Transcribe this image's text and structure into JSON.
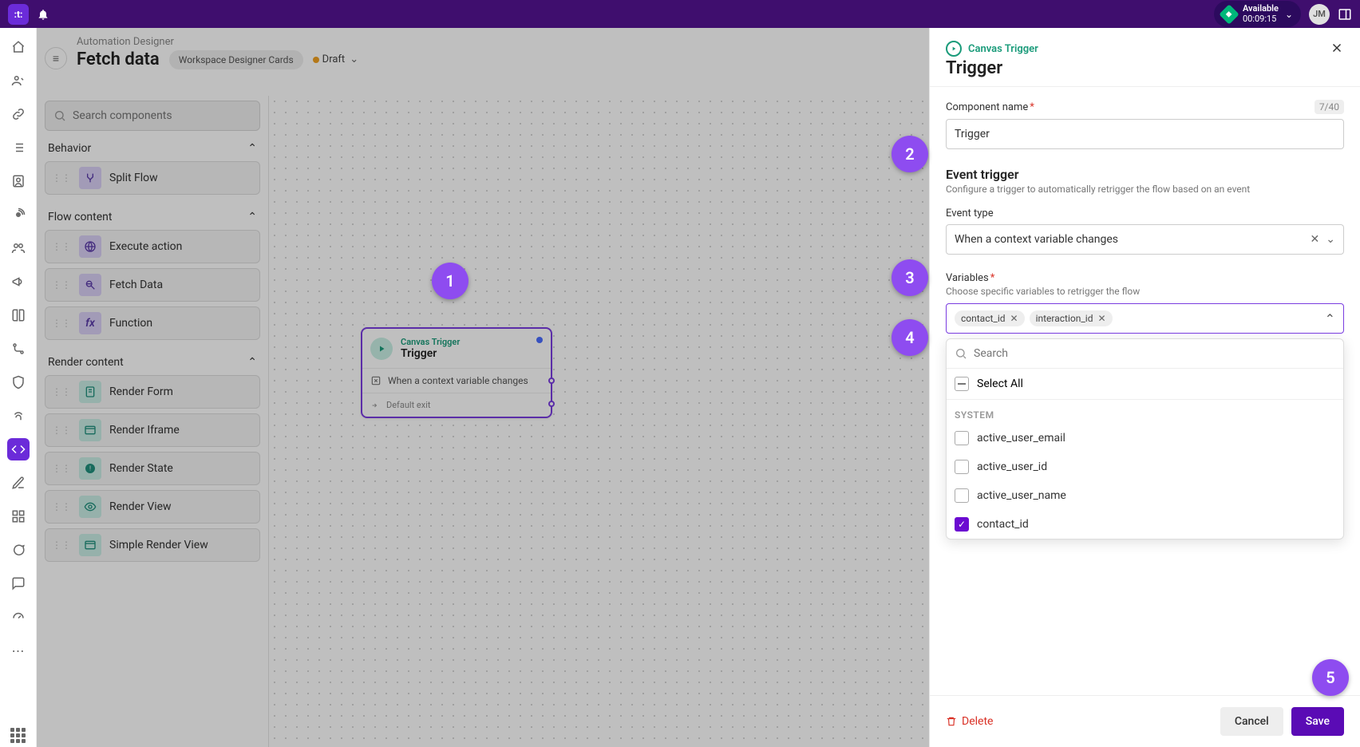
{
  "header": {
    "status_label": "Available",
    "status_time": "00:09:15",
    "user_initials": "JM"
  },
  "workspace": {
    "breadcrumb": "Automation Designer",
    "title": "Fetch data",
    "subtitle_pill": "Workspace Designer Cards",
    "status": "Draft",
    "search_placeholder": "Search components",
    "sections": {
      "behavior": {
        "label": "Behavior",
        "items": [
          "Split Flow"
        ]
      },
      "flow": {
        "label": "Flow content",
        "items": [
          "Execute action",
          "Fetch Data",
          "Function"
        ]
      },
      "render": {
        "label": "Render content",
        "items": [
          "Render Form",
          "Render Iframe",
          "Render State",
          "Render View",
          "Simple Render View"
        ]
      }
    }
  },
  "canvas_card": {
    "type_label": "Canvas Trigger",
    "title": "Trigger",
    "row1": "When a context variable changes",
    "row2": "Default exit"
  },
  "panel": {
    "type_label": "Canvas Trigger",
    "title": "Trigger",
    "component_name_label": "Component name",
    "component_name_value": "Trigger",
    "char_count": "7/40",
    "event_trigger_title": "Event trigger",
    "event_trigger_sub": "Configure a trigger to automatically retrigger the flow based on an event",
    "event_type_label": "Event type",
    "event_type_value": "When a context variable changes",
    "variables_label": "Variables",
    "variables_help": "Choose specific variables to retrigger the flow",
    "chips": [
      "contact_id",
      "interaction_id"
    ],
    "dd_search_placeholder": "Search",
    "dd_select_all": "Select All",
    "dd_group": "SYSTEM",
    "dd_items": [
      {
        "label": "active_user_email",
        "checked": false
      },
      {
        "label": "active_user_id",
        "checked": false
      },
      {
        "label": "active_user_name",
        "checked": false
      },
      {
        "label": "contact_id",
        "checked": true
      }
    ],
    "delete": "Delete",
    "cancel": "Cancel",
    "save": "Save"
  },
  "annotations": [
    "1",
    "2",
    "3",
    "4",
    "5"
  ]
}
